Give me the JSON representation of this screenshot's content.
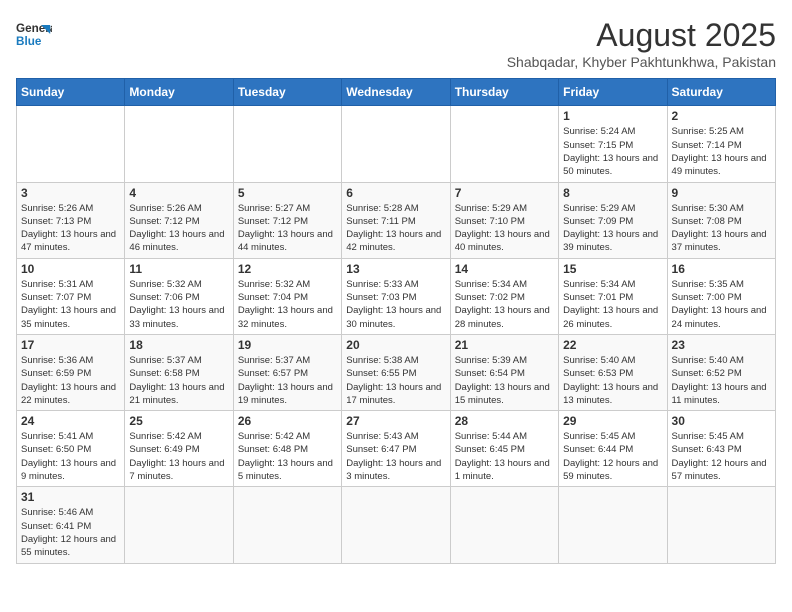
{
  "header": {
    "logo_line1": "General",
    "logo_line2": "Blue",
    "main_title": "August 2025",
    "subtitle": "Shabqadar, Khyber Pakhtunkhwa, Pakistan"
  },
  "weekdays": [
    "Sunday",
    "Monday",
    "Tuesday",
    "Wednesday",
    "Thursday",
    "Friday",
    "Saturday"
  ],
  "weeks": [
    [
      {
        "day": "",
        "info": ""
      },
      {
        "day": "",
        "info": ""
      },
      {
        "day": "",
        "info": ""
      },
      {
        "day": "",
        "info": ""
      },
      {
        "day": "",
        "info": ""
      },
      {
        "day": "1",
        "info": "Sunrise: 5:24 AM\nSunset: 7:15 PM\nDaylight: 13 hours and 50 minutes."
      },
      {
        "day": "2",
        "info": "Sunrise: 5:25 AM\nSunset: 7:14 PM\nDaylight: 13 hours and 49 minutes."
      }
    ],
    [
      {
        "day": "3",
        "info": "Sunrise: 5:26 AM\nSunset: 7:13 PM\nDaylight: 13 hours and 47 minutes."
      },
      {
        "day": "4",
        "info": "Sunrise: 5:26 AM\nSunset: 7:12 PM\nDaylight: 13 hours and 46 minutes."
      },
      {
        "day": "5",
        "info": "Sunrise: 5:27 AM\nSunset: 7:12 PM\nDaylight: 13 hours and 44 minutes."
      },
      {
        "day": "6",
        "info": "Sunrise: 5:28 AM\nSunset: 7:11 PM\nDaylight: 13 hours and 42 minutes."
      },
      {
        "day": "7",
        "info": "Sunrise: 5:29 AM\nSunset: 7:10 PM\nDaylight: 13 hours and 40 minutes."
      },
      {
        "day": "8",
        "info": "Sunrise: 5:29 AM\nSunset: 7:09 PM\nDaylight: 13 hours and 39 minutes."
      },
      {
        "day": "9",
        "info": "Sunrise: 5:30 AM\nSunset: 7:08 PM\nDaylight: 13 hours and 37 minutes."
      }
    ],
    [
      {
        "day": "10",
        "info": "Sunrise: 5:31 AM\nSunset: 7:07 PM\nDaylight: 13 hours and 35 minutes."
      },
      {
        "day": "11",
        "info": "Sunrise: 5:32 AM\nSunset: 7:06 PM\nDaylight: 13 hours and 33 minutes."
      },
      {
        "day": "12",
        "info": "Sunrise: 5:32 AM\nSunset: 7:04 PM\nDaylight: 13 hours and 32 minutes."
      },
      {
        "day": "13",
        "info": "Sunrise: 5:33 AM\nSunset: 7:03 PM\nDaylight: 13 hours and 30 minutes."
      },
      {
        "day": "14",
        "info": "Sunrise: 5:34 AM\nSunset: 7:02 PM\nDaylight: 13 hours and 28 minutes."
      },
      {
        "day": "15",
        "info": "Sunrise: 5:34 AM\nSunset: 7:01 PM\nDaylight: 13 hours and 26 minutes."
      },
      {
        "day": "16",
        "info": "Sunrise: 5:35 AM\nSunset: 7:00 PM\nDaylight: 13 hours and 24 minutes."
      }
    ],
    [
      {
        "day": "17",
        "info": "Sunrise: 5:36 AM\nSunset: 6:59 PM\nDaylight: 13 hours and 22 minutes."
      },
      {
        "day": "18",
        "info": "Sunrise: 5:37 AM\nSunset: 6:58 PM\nDaylight: 13 hours and 21 minutes."
      },
      {
        "day": "19",
        "info": "Sunrise: 5:37 AM\nSunset: 6:57 PM\nDaylight: 13 hours and 19 minutes."
      },
      {
        "day": "20",
        "info": "Sunrise: 5:38 AM\nSunset: 6:55 PM\nDaylight: 13 hours and 17 minutes."
      },
      {
        "day": "21",
        "info": "Sunrise: 5:39 AM\nSunset: 6:54 PM\nDaylight: 13 hours and 15 minutes."
      },
      {
        "day": "22",
        "info": "Sunrise: 5:40 AM\nSunset: 6:53 PM\nDaylight: 13 hours and 13 minutes."
      },
      {
        "day": "23",
        "info": "Sunrise: 5:40 AM\nSunset: 6:52 PM\nDaylight: 13 hours and 11 minutes."
      }
    ],
    [
      {
        "day": "24",
        "info": "Sunrise: 5:41 AM\nSunset: 6:50 PM\nDaylight: 13 hours and 9 minutes."
      },
      {
        "day": "25",
        "info": "Sunrise: 5:42 AM\nSunset: 6:49 PM\nDaylight: 13 hours and 7 minutes."
      },
      {
        "day": "26",
        "info": "Sunrise: 5:42 AM\nSunset: 6:48 PM\nDaylight: 13 hours and 5 minutes."
      },
      {
        "day": "27",
        "info": "Sunrise: 5:43 AM\nSunset: 6:47 PM\nDaylight: 13 hours and 3 minutes."
      },
      {
        "day": "28",
        "info": "Sunrise: 5:44 AM\nSunset: 6:45 PM\nDaylight: 13 hours and 1 minute."
      },
      {
        "day": "29",
        "info": "Sunrise: 5:45 AM\nSunset: 6:44 PM\nDaylight: 12 hours and 59 minutes."
      },
      {
        "day": "30",
        "info": "Sunrise: 5:45 AM\nSunset: 6:43 PM\nDaylight: 12 hours and 57 minutes."
      }
    ],
    [
      {
        "day": "31",
        "info": "Sunrise: 5:46 AM\nSunset: 6:41 PM\nDaylight: 12 hours and 55 minutes."
      },
      {
        "day": "",
        "info": ""
      },
      {
        "day": "",
        "info": ""
      },
      {
        "day": "",
        "info": ""
      },
      {
        "day": "",
        "info": ""
      },
      {
        "day": "",
        "info": ""
      },
      {
        "day": "",
        "info": ""
      }
    ]
  ]
}
